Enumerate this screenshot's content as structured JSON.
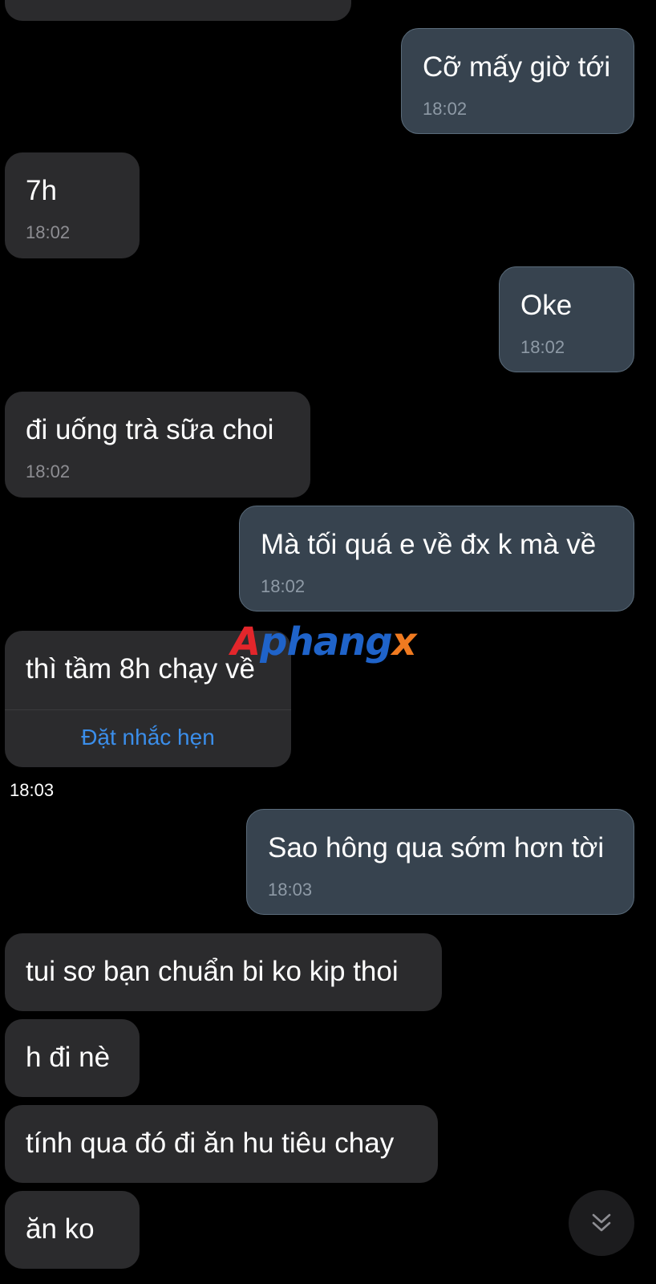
{
  "watermark": {
    "part_a": "A",
    "part_mid": "phang",
    "part_x": "x"
  },
  "messages": [
    {
      "id": "m1",
      "direction": "outgoing",
      "text": "Cỡ mấy giờ tới",
      "time": "18:02"
    },
    {
      "id": "m2",
      "direction": "incoming",
      "text": "7h",
      "time": "18:02"
    },
    {
      "id": "m3",
      "direction": "outgoing",
      "text": "Oke",
      "time": "18:02"
    },
    {
      "id": "m4",
      "direction": "incoming",
      "text": "đi uống trà sữa choi",
      "time": "18:02"
    },
    {
      "id": "m5",
      "direction": "outgoing",
      "text": "Mà tối quá e về đx k mà về",
      "time": "18:02"
    },
    {
      "id": "m6",
      "direction": "incoming",
      "text": "thì tầm 8h chạy về",
      "action": "Đặt nhắc hẹn",
      "time": "18:03"
    },
    {
      "id": "m7",
      "direction": "outgoing",
      "text": "Sao hông qua sớm hơn tời",
      "time": "18:03"
    },
    {
      "id": "m8",
      "direction": "incoming",
      "text": "tui sơ bạn chuẩn bi ko kip thoi"
    },
    {
      "id": "m9",
      "direction": "incoming",
      "text": "h đi nè"
    },
    {
      "id": "m10",
      "direction": "incoming",
      "text": "tính qua đó đi ăn hu tiêu chay"
    },
    {
      "id": "m11",
      "direction": "incoming",
      "text": "ăn ko"
    }
  ],
  "icons": {
    "scroll_down": "double-chevron-down-icon"
  },
  "colors": {
    "background": "#000000",
    "incoming_bubble": "#2b2b2d",
    "outgoing_bubble": "#37434f",
    "link": "#3b8eea"
  }
}
